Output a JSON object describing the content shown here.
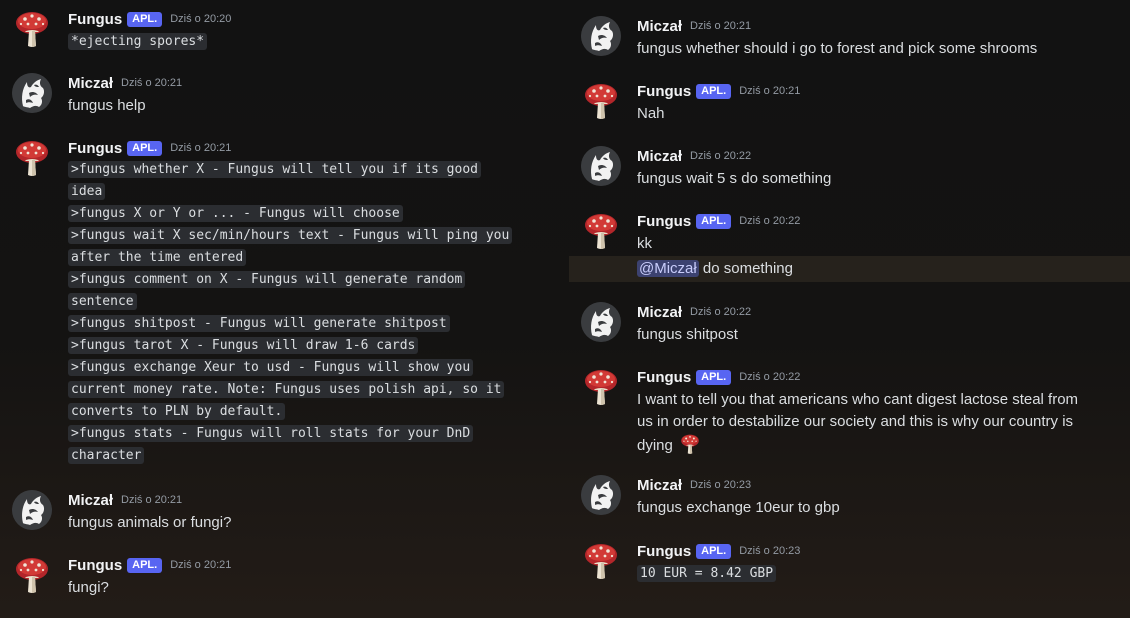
{
  "users": {
    "fungus": {
      "name": "Fungus",
      "tag": "APL."
    },
    "miczal": {
      "name": "Miczał"
    }
  },
  "left_messages": [
    {
      "time": "Dziś o 20:20",
      "code": "*ejecting spores*"
    },
    {
      "time": "Dziś o 20:21",
      "text": "fungus help"
    },
    {
      "time": "Dziś o 20:21",
      "help_lines": [
        ">fungus whether X - Fungus will tell you if its good",
        "idea",
        ">fungus X or Y or ... - Fungus will choose",
        ">fungus wait X sec/min/hours text - Fungus will ping you",
        "after the time entered",
        ">fungus comment on X - Fungus will generate random",
        "sentence",
        ">fungus shitpost - Fungus will generate shitpost",
        ">fungus tarot X - Fungus will draw 1-6 cards",
        ">fungus exchange Xeur to usd - Fungus will show you",
        "current money rate. Note: Fungus uses polish api, so it",
        "converts to PLN by default.",
        ">fungus stats - Fungus will roll stats for your DnD",
        "character"
      ]
    },
    {
      "time": "Dziś o 20:21",
      "text": "fungus animals or fungi?"
    },
    {
      "time": "Dziś o 20:21",
      "text": "fungi?"
    }
  ],
  "right_messages": [
    {
      "time": "Dziś o 20:21",
      "text": "fungus whether should i go to forest and pick some shrooms"
    },
    {
      "time": "Dziś o 20:21",
      "text": "Nah"
    },
    {
      "time": "Dziś o 20:22",
      "text": "fungus wait 5 s do something"
    },
    {
      "time": "Dziś o 20:22",
      "text": "kk",
      "followup_mention": "@Miczał",
      "followup_text": " do something"
    },
    {
      "time": "Dziś o 20:22",
      "text": "fungus shitpost"
    },
    {
      "time": "Dziś o 20:22",
      "text_lines": [
        "I want to tell you that americans who cant digest lactose steal from",
        "us in order to destabilize our society and this is why our country is",
        "dying"
      ]
    },
    {
      "time": "Dziś o 20:23",
      "text": "fungus exchange 10eur to gbp"
    },
    {
      "time": "Dziś o 20:23",
      "code": "10 EUR = 8.42 GBP"
    }
  ],
  "colors": {
    "accent": "#5865f2",
    "background": "#121212",
    "mention_bg": "#3c4270"
  }
}
